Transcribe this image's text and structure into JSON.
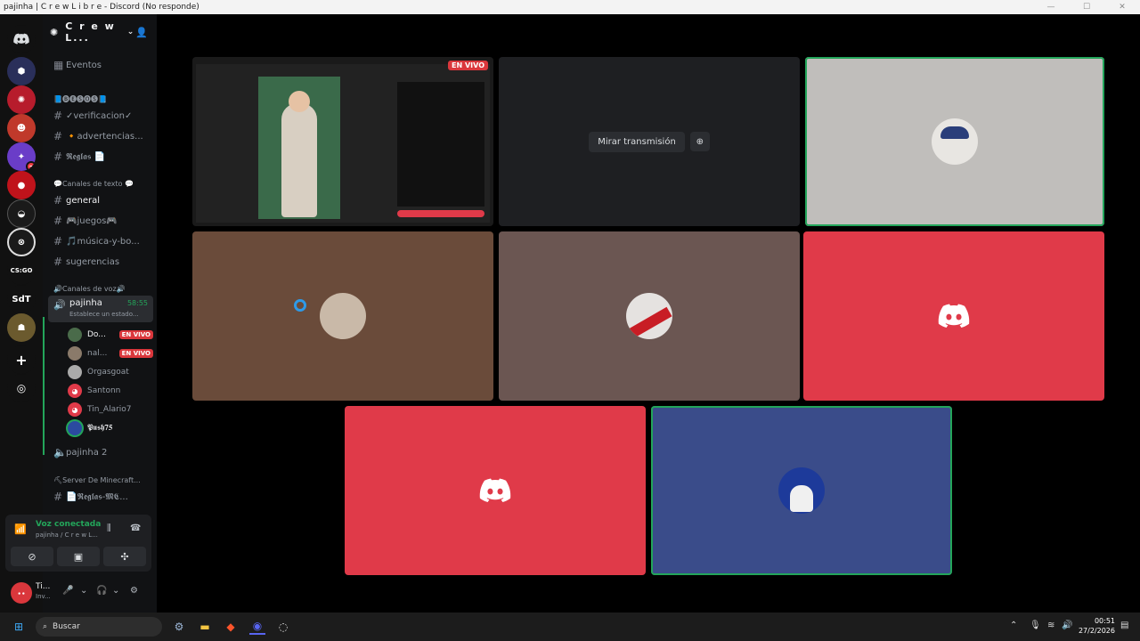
{
  "window": {
    "title": "pajinha | C r e w L i b r e - Discord (No responde)"
  },
  "colors": {
    "accent_green": "#23a55a",
    "live_red": "#da373c",
    "discord_red": "#e03a49",
    "blurple": "#5865f2"
  },
  "server": {
    "name": "C r e w L..."
  },
  "channels": {
    "events": "Eventos",
    "cat1": "📘🅑🅔🅢🅞🅢📘",
    "verif": "✓verificacion✓",
    "advert": "🔸advertencias...",
    "rules": "𝕽𝖊𝖌𝖑𝖆𝖘 📄",
    "cat_text": "💬Canales de texto 💬",
    "general": "general",
    "games": "🎮juegos🎮",
    "music": "🎵música-y-bo...",
    "suggest": "sugerencias",
    "cat_voice": "🔊Canales de voz🔊",
    "voice_active": {
      "name": "pajinha",
      "time": "58:55",
      "status": "Establece un estado..."
    },
    "voice_users": [
      {
        "name": "Do...",
        "live": "EN VIVO"
      },
      {
        "name": "nal...",
        "live": "EN VIVO"
      },
      {
        "name": "Orgasgoat"
      },
      {
        "name": "Santonn"
      },
      {
        "name": "Tin_Alario7"
      },
      {
        "name": "𝕻𝖚𝖘𝖍𝟕𝟓"
      }
    ],
    "voice2": "pajinha 2",
    "cat_mc": "⛏Server De Minecraft...",
    "mc_rules": "📄𝕽𝖊𝖌𝖑𝖆𝖘-𝕸𝕮..."
  },
  "voice_panel": {
    "title": "Voz conectada",
    "sub": "pajinha / C r e w L..."
  },
  "user_panel": {
    "name": "Ti...",
    "status": "Inv..."
  },
  "stage": {
    "stream_live": "EN VIVO",
    "watch_label": "Mirar transmisión"
  },
  "taskbar": {
    "search": "Buscar",
    "time": "00:51",
    "date": "27/2/2026"
  },
  "icons": [
    "discord-icon",
    "hash-icon",
    "speaker-icon",
    "chevron-down-icon",
    "add-user-icon",
    "mic-icon",
    "headset-icon",
    "gear-icon",
    "search-icon",
    "windows-icon"
  ]
}
